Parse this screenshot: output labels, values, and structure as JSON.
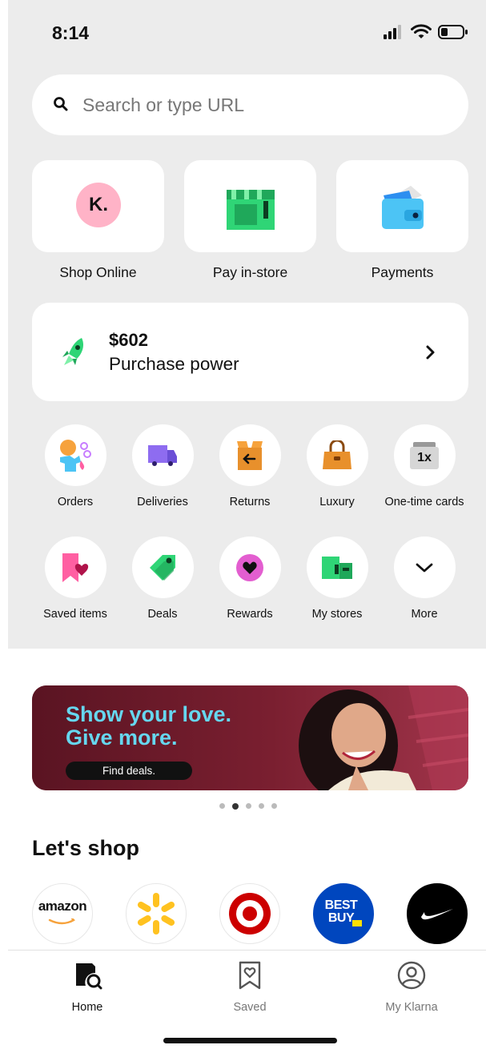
{
  "status_bar": {
    "time": "8:14"
  },
  "search": {
    "placeholder": "Search or type URL"
  },
  "tiles": [
    {
      "label": "Shop Online",
      "icon": "klarna-logo-icon",
      "logo_text": "K."
    },
    {
      "label": "Pay in-store",
      "icon": "storefront-icon"
    },
    {
      "label": "Payments",
      "icon": "wallet-icon"
    }
  ],
  "purchase_power": {
    "amount": "$602",
    "label": "Purchase power"
  },
  "quick_actions": [
    {
      "label": "Orders",
      "icon": "orders-icon"
    },
    {
      "label": "Deliveries",
      "icon": "delivery-truck-icon"
    },
    {
      "label": "Returns",
      "icon": "return-box-icon"
    },
    {
      "label": "Luxury",
      "icon": "luxury-bag-icon"
    },
    {
      "label": "One-time cards",
      "icon": "one-time-card-icon",
      "badge": "1x"
    },
    {
      "label": "Saved items",
      "icon": "saved-items-icon"
    },
    {
      "label": "Deals",
      "icon": "deals-tag-icon"
    },
    {
      "label": "Rewards",
      "icon": "rewards-heart-icon"
    },
    {
      "label": "My stores",
      "icon": "my-stores-icon"
    },
    {
      "label": "More",
      "icon": "chevron-down-icon"
    }
  ],
  "banner": {
    "headline_1": "Show your love.",
    "headline_2": "Give more.",
    "cta": "Find deals."
  },
  "carousel": {
    "count": 5,
    "active_index": 1
  },
  "lets_shop": {
    "title": "Let's shop",
    "brands": [
      {
        "name": "amazon",
        "icon": "amazon-logo-icon"
      },
      {
        "name": "walmart",
        "icon": "walmart-spark-icon"
      },
      {
        "name": "target",
        "icon": "target-logo-icon"
      },
      {
        "name": "BEST BUY",
        "icon": "best-buy-logo-icon"
      },
      {
        "name": "nike",
        "icon": "nike-swoosh-icon"
      }
    ]
  },
  "tab_bar": {
    "items": [
      {
        "label": "Home",
        "icon": "home-search-icon",
        "active": true
      },
      {
        "label": "Saved",
        "icon": "saved-heart-icon",
        "active": false
      },
      {
        "label": "My Klarna",
        "icon": "profile-icon",
        "active": false
      }
    ]
  },
  "colors": {
    "klarna_pink": "#ffb3c7",
    "accent_green": "#2fd576",
    "banner_bg": "#6f1c2b",
    "banner_text": "#66d7ef"
  }
}
